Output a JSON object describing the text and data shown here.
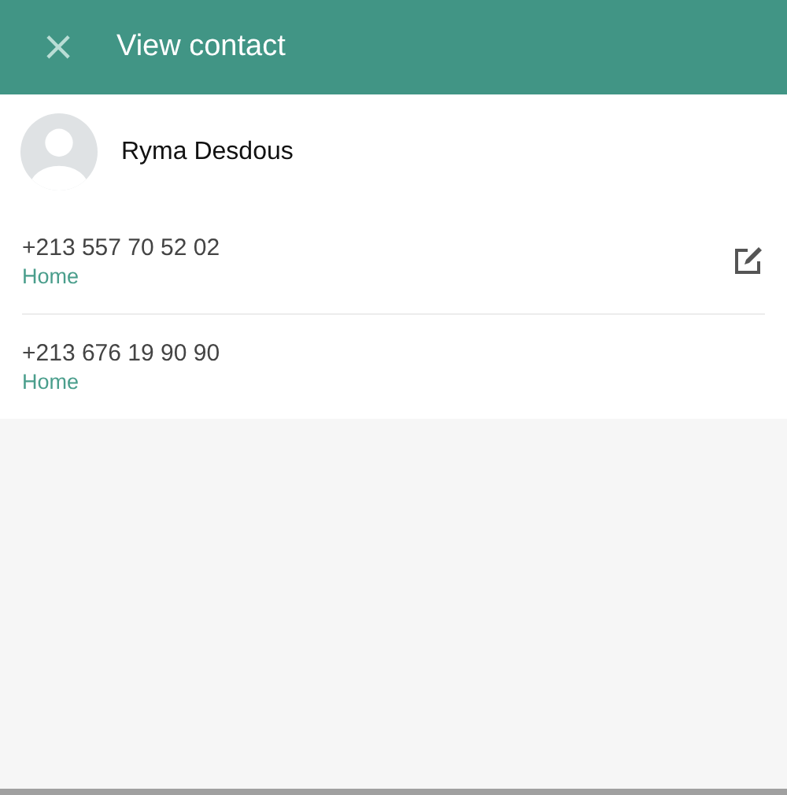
{
  "header": {
    "close": "×",
    "title": "View contact"
  },
  "contact": {
    "name": "Ryma Desdous"
  },
  "phones": [
    {
      "number": "+213 557 70 52 02",
      "label": "Home",
      "edit_button": true
    },
    {
      "number": "+213 676 19 90 90",
      "label": "Home",
      "edit_button": false
    }
  ]
}
